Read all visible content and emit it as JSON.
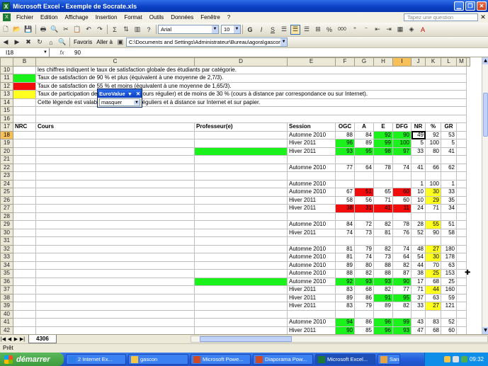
{
  "window": {
    "title": "Microsoft Excel - Exemple de Socrate.xls"
  },
  "menu": {
    "items": [
      "Fichier",
      "Edition",
      "Affichage",
      "Insertion",
      "Format",
      "Outils",
      "Données",
      "Fenêtre",
      "?"
    ],
    "help_placeholder": "Tapez une question"
  },
  "toolbar": {
    "font_name": "Arial",
    "font_size": "10",
    "bold": "G",
    "italic": "I",
    "underline": "S",
    "favorites": "Favoris",
    "goto": "Aller à",
    "address": "C:\\Documents and Settings\\Administrateur\\Bureau\\agora\\gascon\\E",
    "percent": "%",
    "thousands": "000",
    "sigma": "Σ"
  },
  "formula_bar": {
    "cell_ref": "I18",
    "fx": "fx",
    "value": "90"
  },
  "columns": [
    "B",
    "C",
    "D",
    "E",
    "F",
    "G",
    "H",
    "I",
    "J",
    "K",
    "L",
    "M"
  ],
  "selected_column": "I",
  "selected_row": "18",
  "legend_rows": [
    {
      "row": "10",
      "fill": "",
      "text": "les chiffres indiquent le taux de satisfaction globale des étudiants par catégorie."
    },
    {
      "row": "11",
      "fill": "g",
      "text": "Taux de satisfaction de 90 % et plus (équivalent à une moyenne de 2,7/3)."
    },
    {
      "row": "12",
      "fill": "r",
      "text": "Taux de satisfaction de 55 % et moins (équivalent à une moyenne de 1,65/3)."
    },
    {
      "row": "13",
      "fill": "y",
      "text": "Taux de participation de moins de 30 % (cours régulier) et de moins de 30 % (cours à distance par correspondance ou sur Internet)."
    },
    {
      "row": "14",
      "fill": "",
      "text": "Cette légende est valable pour les cours réguliers et à distance sur Internet et sur papier."
    },
    {
      "row": "15",
      "fill": "",
      "text": ""
    },
    {
      "row": "16",
      "fill": "",
      "text": ""
    }
  ],
  "header_row": {
    "row": "17",
    "cells": [
      "NRC",
      "Cours",
      "Professeur(e)",
      "Session",
      "OGC",
      "A",
      "E",
      "DFG",
      "NR",
      "%",
      "GR"
    ]
  },
  "data_rows": [
    {
      "row": "18",
      "d": "",
      "e": "Automne 2010",
      "f": "88",
      "g": "84",
      "h": "92",
      "i": "90",
      "j": "49",
      "k": "92",
      "l": "53",
      "c": {
        "h": "g",
        "i": "g"
      }
    },
    {
      "row": "19",
      "d": "",
      "e": "Hiver 2011",
      "f": "96",
      "g": "89",
      "h": "99",
      "i": "100",
      "j": "5",
      "k": "100",
      "l": "5",
      "c": {
        "f": "g",
        "h": "g",
        "i": "g"
      }
    },
    {
      "row": "20",
      "d": "g",
      "e": "Hiver 2011",
      "f": "93",
      "g": "95",
      "h": "98",
      "i": "97",
      "j": "33",
      "k": "80",
      "l": "41",
      "c": {
        "f": "g",
        "g": "g",
        "h": "g",
        "i": "g"
      }
    },
    {
      "row": "21",
      "d": "",
      "e": "",
      "f": "",
      "g": "",
      "h": "",
      "i": "",
      "j": "",
      "k": "",
      "l": "",
      "c": {}
    },
    {
      "row": "22",
      "d": "",
      "e": "Automne 2010",
      "f": "77",
      "g": "64",
      "h": "78",
      "i": "74",
      "j": "41",
      "k": "66",
      "l": "62",
      "c": {}
    },
    {
      "row": "23",
      "d": "",
      "e": "",
      "f": "",
      "g": "",
      "h": "",
      "i": "",
      "j": "",
      "k": "",
      "l": "",
      "c": {}
    },
    {
      "row": "24",
      "d": "",
      "e": "Automne 2010",
      "f": "",
      "g": "",
      "h": "",
      "i": "",
      "j": "1",
      "k": "100",
      "l": "1",
      "c": {}
    },
    {
      "row": "25",
      "d": "",
      "e": "Automne 2010",
      "f": "67",
      "g": "51",
      "h": "65",
      "i": "60",
      "j": "10",
      "k": "30",
      "l": "33",
      "c": {
        "g": "r",
        "i": "r",
        "k": "y"
      }
    },
    {
      "row": "26",
      "d": "",
      "e": "Hiver 2011",
      "f": "58",
      "g": "56",
      "h": "71",
      "i": "60",
      "j": "10",
      "k": "29",
      "l": "35",
      "c": {
        "k": "y"
      }
    },
    {
      "row": "27",
      "d": "",
      "e": "Hiver 2011",
      "f": "38",
      "g": "31",
      "h": "41",
      "i": "11",
      "j": "24",
      "k": "71",
      "l": "34",
      "c": {
        "f": "r",
        "g": "r",
        "h": "r",
        "i": "r"
      }
    },
    {
      "row": "28",
      "d": "",
      "e": "",
      "f": "",
      "g": "",
      "h": "",
      "i": "",
      "j": "",
      "k": "",
      "l": "",
      "c": {}
    },
    {
      "row": "29",
      "d": "",
      "e": "Automne 2010",
      "f": "84",
      "g": "72",
      "h": "82",
      "i": "78",
      "j": "28",
      "k": "55",
      "l": "51",
      "c": {
        "k": "y"
      }
    },
    {
      "row": "30",
      "d": "",
      "e": "Hiver 2011",
      "f": "74",
      "g": "73",
      "h": "81",
      "i": "76",
      "j": "52",
      "k": "90",
      "l": "58",
      "c": {}
    },
    {
      "row": "31",
      "d": "",
      "e": "",
      "f": "",
      "g": "",
      "h": "",
      "i": "",
      "j": "",
      "k": "",
      "l": "",
      "c": {}
    },
    {
      "row": "32",
      "d": "",
      "e": "Automne 2010",
      "f": "81",
      "g": "79",
      "h": "82",
      "i": "74",
      "j": "48",
      "k": "27",
      "l": "180",
      "c": {
        "k": "y"
      }
    },
    {
      "row": "33",
      "d": "",
      "e": "Automne 2010",
      "f": "81",
      "g": "74",
      "h": "73",
      "i": "64",
      "j": "54",
      "k": "30",
      "l": "178",
      "c": {
        "k": "y"
      }
    },
    {
      "row": "34",
      "d": "",
      "e": "Automne 2010",
      "f": "89",
      "g": "80",
      "h": "88",
      "i": "82",
      "j": "44",
      "k": "70",
      "l": "63",
      "c": {}
    },
    {
      "row": "35",
      "d": "",
      "e": "Automne 2010",
      "f": "88",
      "g": "82",
      "h": "88",
      "i": "87",
      "j": "38",
      "k": "25",
      "l": "153",
      "c": {
        "k": "y"
      }
    },
    {
      "row": "36",
      "d": "g",
      "e": "Automne 2010",
      "f": "92",
      "g": "93",
      "h": "93",
      "i": "90",
      "j": "17",
      "k": "68",
      "l": "25",
      "c": {
        "f": "g",
        "g": "g",
        "h": "g",
        "i": "g"
      }
    },
    {
      "row": "37",
      "d": "",
      "e": "Hiver 2011",
      "f": "83",
      "g": "68",
      "h": "82",
      "i": "77",
      "j": "71",
      "k": "44",
      "l": "160",
      "c": {
        "k": "y"
      }
    },
    {
      "row": "38",
      "d": "",
      "e": "Hiver 2011",
      "f": "89",
      "g": "86",
      "h": "91",
      "i": "95",
      "j": "37",
      "k": "63",
      "l": "59",
      "c": {
        "h": "g",
        "i": "g"
      }
    },
    {
      "row": "39",
      "d": "",
      "e": "Hiver 2011",
      "f": "83",
      "g": "79",
      "h": "89",
      "i": "82",
      "j": "33",
      "k": "27",
      "l": "121",
      "c": {
        "k": "y"
      }
    },
    {
      "row": "40",
      "d": "",
      "e": "",
      "f": "",
      "g": "",
      "h": "",
      "i": "",
      "j": "",
      "k": "",
      "l": "",
      "c": {}
    },
    {
      "row": "41",
      "d": "",
      "e": "Automne 2010",
      "f": "94",
      "g": "86",
      "h": "96",
      "i": "99",
      "j": "43",
      "k": "83",
      "l": "52",
      "c": {
        "f": "g",
        "h": "g",
        "i": "g"
      }
    },
    {
      "row": "42",
      "d": "",
      "e": "Hiver 2011",
      "f": "90",
      "g": "85",
      "h": "96",
      "i": "93",
      "j": "47",
      "k": "68",
      "l": "60",
      "c": {
        "f": "g",
        "h": "g",
        "i": "g"
      }
    }
  ],
  "popup": {
    "title": "EuroValue",
    "value": "masquer"
  },
  "sheet_tab": "4306",
  "status": "Prêt",
  "taskbar": {
    "start": "démarrer",
    "tasks": [
      "2 Internet Ex...",
      "gascon",
      "Microsoft Powe...",
      "Diaporama Pow...",
      "Microsoft Excel...",
      "Sans titre - Paint"
    ],
    "active_task": 4,
    "time": "09:32"
  },
  "colors": {
    "green": "#1bf21b",
    "red": "#f20c0c",
    "yellow": "#ffff20",
    "titlebar": "#0a3fc4"
  }
}
